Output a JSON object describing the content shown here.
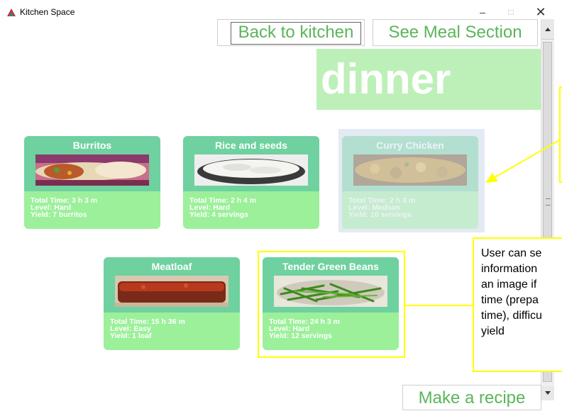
{
  "window": {
    "title": "Kitchen Space",
    "minimize_glyph": "–",
    "maximize_glyph": "□",
    "close_glyph": "✕"
  },
  "nav": {
    "back_label": "Back to kitchen",
    "meal_section_label": "See Meal Section"
  },
  "meal_banner": "dinner",
  "cards": [
    {
      "title": "Burritos",
      "total_time": "Total Time: 3 h 3 m",
      "level": "Level: Hard",
      "yield": "Yield: 7 burritos",
      "image": "burrito-image"
    },
    {
      "title": "Rice and seeds",
      "total_time": "Total Time: 2 h 4 m",
      "level": "Level: Hard",
      "yield": "Yield: 4 servings",
      "image": "rice-image"
    },
    {
      "title": "Curry Chicken",
      "total_time": "Total Time: 2 h 3 m",
      "level": "Level: Medium",
      "yield": "Yield: 10 servings",
      "image": "curry-image"
    },
    {
      "title": "Meatloaf",
      "total_time": "Total Time: 15 h 36 m",
      "level": "Level: Easy",
      "yield": "Yield: 1 loaf",
      "image": "meatloaf-image"
    },
    {
      "title": "Tender Green Beans",
      "total_time": "Total Time: 24 h 3 m",
      "level": "Level: Hard",
      "yield": "Yield: 12 servings",
      "image": "green-beans-image"
    }
  ],
  "annotation": {
    "lines": [
      "User can se",
      "information",
      "an image if",
      "time (prepa",
      "time), difficu",
      "yield"
    ]
  },
  "make_recipe_label": "Make a recipe",
  "colors": {
    "accent_green": "#5bb55a",
    "card_header": "#6fd19f",
    "card_body": "#9cf09a",
    "banner": "#bdf0b8",
    "annotation": "#ffff00"
  }
}
